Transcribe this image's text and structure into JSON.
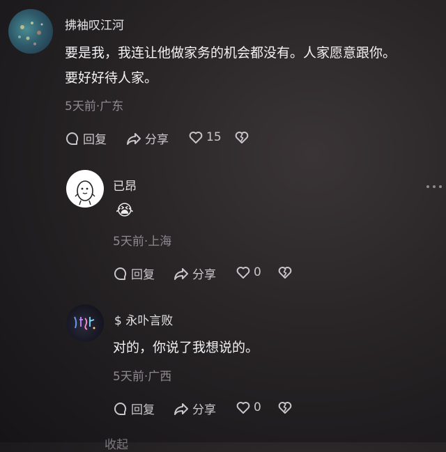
{
  "main_comment": {
    "username": "拂袖叹江河",
    "line1": "要是我，我连让他做家务的机会都没有。人家愿意跟你。",
    "line2": "要好好待人家。",
    "meta": "5天前·广东",
    "reply_label": "回复",
    "share_label": "分享",
    "like_count": "15"
  },
  "replies": [
    {
      "username": "已昂",
      "emoji": "😭",
      "meta": "5天前·上海",
      "reply_label": "回复",
      "share_label": "分享",
      "like_count": "0"
    },
    {
      "username": "$ 永卟言败",
      "content": "对的，你说了我想说的。",
      "meta": "5天前·广西",
      "reply_label": "回复",
      "share_label": "分享",
      "like_count": "0"
    }
  ],
  "collapse_label": "收起",
  "icons": {
    "reply": "comment-bubble-icon",
    "share": "share-arrow-icon",
    "like": "heart-icon",
    "dislike": "broken-heart-icon",
    "more": "more-dots-icon"
  }
}
